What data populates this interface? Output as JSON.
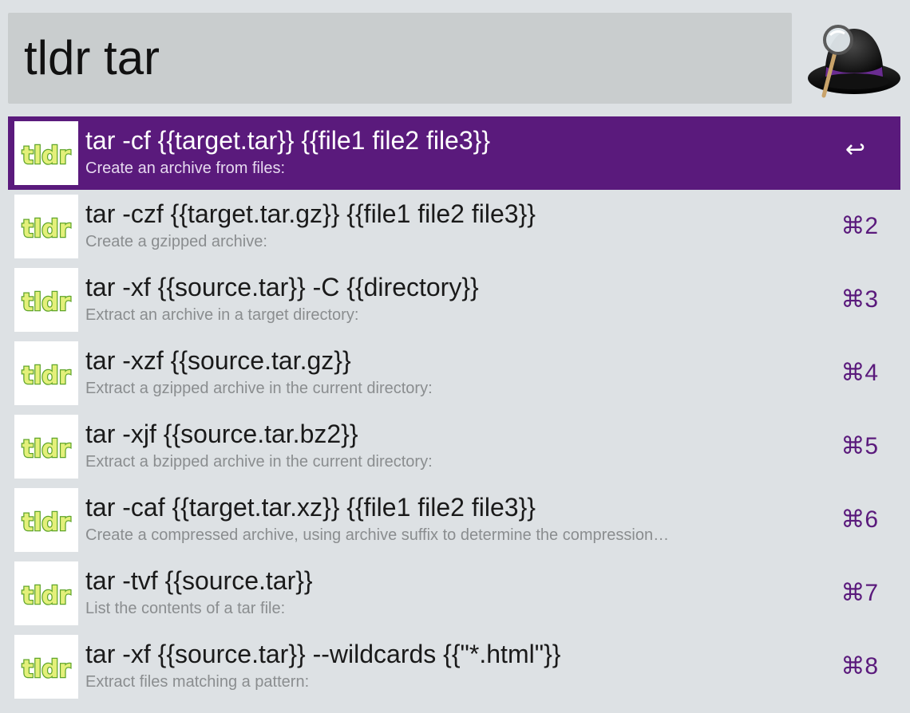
{
  "search": {
    "query": "tldr tar"
  },
  "app_icon": "alfred-hat-icon",
  "item_icon": "tldr-logo-icon",
  "colors": {
    "selection": "#5a1a7c",
    "background": "#dde1e4",
    "search_field": "#c9cdce"
  },
  "results": [
    {
      "title": "tar -cf {{target.tar}} {{file1 file2 file3}}",
      "subtitle": "Create an archive from files:",
      "shortcut": "↩",
      "selected": true
    },
    {
      "title": "tar -czf {{target.tar.gz}} {{file1 file2 file3}}",
      "subtitle": "Create a gzipped archive:",
      "shortcut": "⌘2",
      "selected": false
    },
    {
      "title": "tar -xf {{source.tar}} -C {{directory}}",
      "subtitle": "Extract an archive in a target directory:",
      "shortcut": "⌘3",
      "selected": false
    },
    {
      "title": "tar -xzf {{source.tar.gz}}",
      "subtitle": "Extract a gzipped archive in the current directory:",
      "shortcut": "⌘4",
      "selected": false
    },
    {
      "title": "tar -xjf {{source.tar.bz2}}",
      "subtitle": "Extract a bzipped archive in the current directory:",
      "shortcut": "⌘5",
      "selected": false
    },
    {
      "title": "tar -caf {{target.tar.xz}} {{file1 file2 file3}}",
      "subtitle": "Create a compressed archive, using archive suffix to determine the compression…",
      "shortcut": "⌘6",
      "selected": false
    },
    {
      "title": "tar -tvf {{source.tar}}",
      "subtitle": "List the contents of a tar file:",
      "shortcut": "⌘7",
      "selected": false
    },
    {
      "title": "tar -xf {{source.tar}} --wildcards {{\"*.html\"}}",
      "subtitle": "Extract files matching a pattern:",
      "shortcut": "⌘8",
      "selected": false
    }
  ]
}
